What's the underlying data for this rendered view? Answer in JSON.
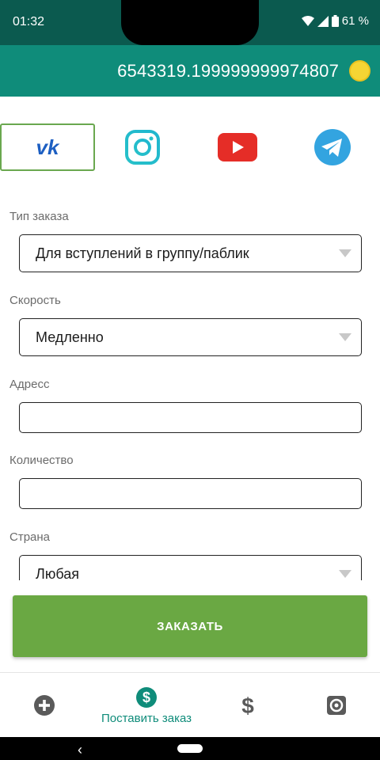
{
  "status": {
    "time": "01:32",
    "battery": "61 %"
  },
  "appbar": {
    "balance": "6543319.199999999974807",
    "coin_icon": "coin-icon"
  },
  "socials": [
    {
      "name": "vk-icon",
      "label": "VK",
      "selected": true
    },
    {
      "name": "instagram-icon",
      "selected": false
    },
    {
      "name": "youtube-icon",
      "selected": false
    },
    {
      "name": "telegram-icon",
      "selected": false
    }
  ],
  "form": {
    "order_type_label": "Тип заказа",
    "order_type_value": "Для вступлений в группу/паблик",
    "speed_label": "Скорость",
    "speed_value": "Медленно",
    "address_label": "Адресс",
    "address_value": "",
    "quantity_label": "Количество",
    "quantity_value": "",
    "country_label": "Страна",
    "country_value": "Любая"
  },
  "order_button": "ЗАКАЗАТЬ",
  "bottom_nav": {
    "active_label": "Поставить заказ"
  },
  "colors": {
    "statusbar": "#0b5a4f",
    "appbar": "#0f8c7a",
    "button": "#6aa843",
    "accent": "#0f8c7a"
  }
}
